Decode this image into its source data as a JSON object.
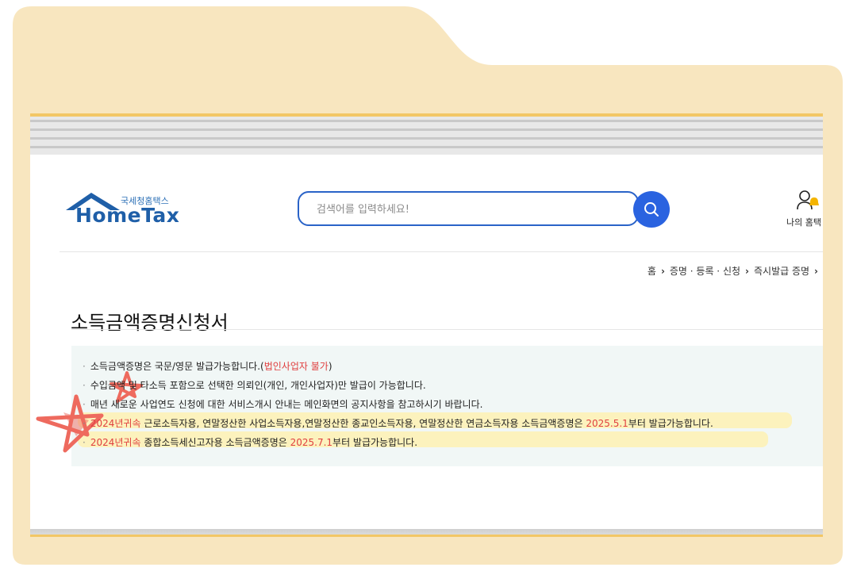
{
  "colors": {
    "folder": "#f8e6bf",
    "accent_blue": "#2a63e0",
    "logo_blue": "#1f5fa8",
    "red_text": "#e04040",
    "highlight": "#fff0aa",
    "scribble_star": "#ee6a5e"
  },
  "header": {
    "logo_korean": "국세청홈택스",
    "logo_text": "HomeTax",
    "search_placeholder": "검색어를 입력하세요!",
    "search_icon": "search-icon",
    "my_hometax_label": "나의 홈택"
  },
  "breadcrumb": [
    "홈",
    "증명 · 등록 · 신청",
    "즉시발급 증명"
  ],
  "page_title": "소득금액증명신청서",
  "notices": [
    {
      "text": "소득금액증명은 국문/영문 발급가능합니다.(",
      "red": "법인사업자 불가",
      "tail": ")"
    },
    {
      "text": "수입금액 및 타소득 포함으로 선택한 의뢰인(개인, 개인사업자)만 발급이 가능합니다."
    },
    {
      "text": "매년 새로운 사업연도 신청에 대한 서비스개시 안내는 메인화면의 공지사항을 참고하시기 바랍니다."
    },
    {
      "red1": "2024년귀속",
      "mid": " 근로소득자용, 연말정산한 사업소득자용,연말정산한 종교인소득자용, 연말정산한 연금소득자용 소득금액증명은 ",
      "red2": "2025.5.1",
      "tail": "부터 발급가능합니다."
    },
    {
      "red1": "2024년귀속",
      "mid": " 종합소득세신고자용 소득금액증명은 ",
      "red2": "2025.7.1",
      "tail": "부터 발급가능합니다."
    }
  ]
}
